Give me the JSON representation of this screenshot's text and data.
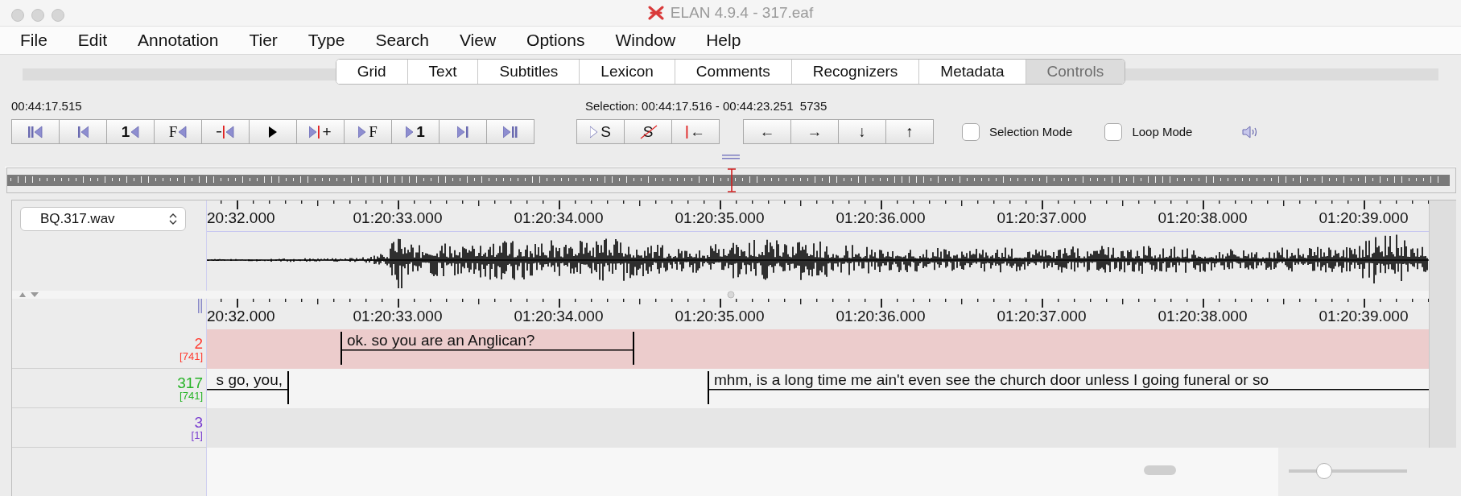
{
  "window": {
    "title": "ELAN 4.9.4 - 317.eaf"
  },
  "menu": [
    "File",
    "Edit",
    "Annotation",
    "Tier",
    "Type",
    "Search",
    "View",
    "Options",
    "Window",
    "Help"
  ],
  "tabs": [
    {
      "label": "Grid",
      "selected": false
    },
    {
      "label": "Text",
      "selected": false
    },
    {
      "label": "Subtitles",
      "selected": false
    },
    {
      "label": "Lexicon",
      "selected": false
    },
    {
      "label": "Comments",
      "selected": false
    },
    {
      "label": "Recognizers",
      "selected": false
    },
    {
      "label": "Metadata",
      "selected": false
    },
    {
      "label": "Controls",
      "selected": true
    }
  ],
  "media_time": "00:44:17.515",
  "selection": "Selection: 00:44:17.516 - 00:44:23.251  5735",
  "player_buttons": [
    {
      "kind": "skip-start"
    },
    {
      "kind": "page-back"
    },
    {
      "kind": "second-back",
      "text": "1"
    },
    {
      "kind": "frame-back",
      "text": "F"
    },
    {
      "kind": "boundary-back"
    },
    {
      "kind": "play"
    },
    {
      "kind": "boundary-forward",
      "text": "+"
    },
    {
      "kind": "frame-forward",
      "text": "F"
    },
    {
      "kind": "second-forward",
      "text": "1"
    },
    {
      "kind": "page-forward"
    },
    {
      "kind": "skip-end"
    }
  ],
  "selection_buttons": [
    {
      "kind": "play-selection",
      "text": "S"
    },
    {
      "kind": "clear-selection",
      "text": "S"
    },
    {
      "kind": "to-selection-begin",
      "text": "←"
    }
  ],
  "navigation_buttons": [
    {
      "kind": "arrow",
      "text": "←"
    },
    {
      "kind": "arrow",
      "text": "→"
    },
    {
      "kind": "arrow",
      "text": "↓"
    },
    {
      "kind": "arrow",
      "text": "↑"
    }
  ],
  "checkboxes": [
    {
      "label": "Selection Mode",
      "checked": false
    },
    {
      "label": "Loop Mode",
      "checked": false
    }
  ],
  "media_player": {
    "file": "BQ.317.wav",
    "ruler_labels": [
      "20:32.000",
      "01:20:33.000",
      "01:20:34.000",
      "01:20:35.000",
      "01:20:36.000",
      "01:20:37.000",
      "01:20:38.000",
      "01:20:39.000"
    ]
  },
  "timeline": {
    "ruler_labels": [
      "20:32.000",
      "01:20:33.000",
      "01:20:34.000",
      "01:20:35.000",
      "01:20:36.000",
      "01:20:37.000",
      "01:20:38.000",
      "01:20:39.000"
    ],
    "tiers": [
      {
        "name": "2",
        "count": "[741]",
        "color": "#ff3b30",
        "active": true,
        "annotations": [
          {
            "text": "ok. so you are an Anglican?"
          }
        ]
      },
      {
        "name": "317",
        "count": "[741]",
        "color": "#27b327",
        "active": false,
        "annotations": [
          {
            "text": "s go, you,"
          },
          {
            "text": "mhm, is a long time me ain't even see the church door unless I going funeral or so"
          }
        ]
      },
      {
        "name": "3",
        "count": "[1]",
        "color": "#7b3fd0",
        "active": false
      }
    ]
  },
  "zoom_slider": {
    "level": 0.3
  }
}
